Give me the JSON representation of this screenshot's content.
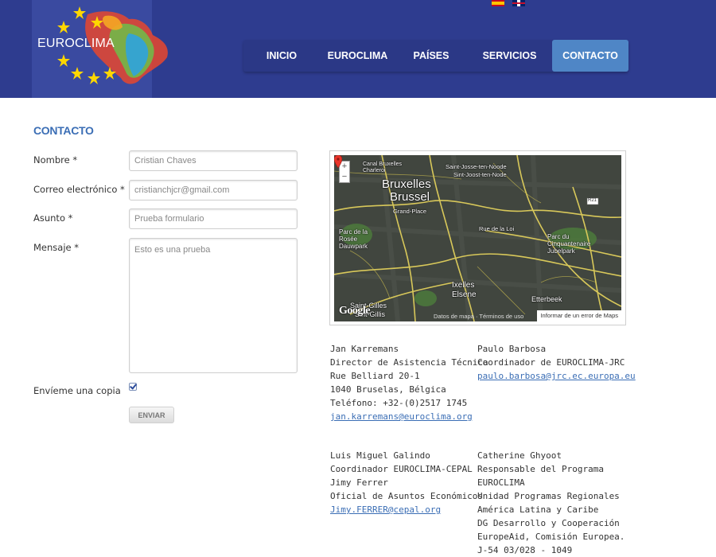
{
  "header": {
    "logo_text": "EUROCLIMA",
    "flags": [
      "flag-spain-icon",
      "flag-uk-icon"
    ],
    "nav": [
      {
        "label": "INICIO",
        "active": false
      },
      {
        "label": "EUROCLIMA",
        "active": false
      },
      {
        "label": "PAÍSES",
        "active": false
      },
      {
        "label": "SERVICIOS",
        "active": false
      },
      {
        "label": "CONTACTO",
        "active": true
      }
    ]
  },
  "page": {
    "title": "CONTACTO"
  },
  "form": {
    "name_label": "Nombre *",
    "name_value": "Cristian Chaves",
    "email_label": "Correo electrónico *",
    "email_value": "cristianchjcr@gmail.com",
    "subject_label": "Asunto *",
    "subject_value": "Prueba formulario",
    "message_label": "Mensaje *",
    "message_value": "Esto es una prueba",
    "copy_label": "Envíeme una copia",
    "copy_checked": true,
    "submit_label": "ENVIAR"
  },
  "map": {
    "zoom_in": "+",
    "zoom_out": "−",
    "labels": {
      "canal": "Canal Bruxelles Charleroi",
      "sjtn_fr": "Saint-Josse-ten-Noode",
      "sjtn_nl": "Sint-Joost-ten-Node",
      "bruxelles": "Bruxelles",
      "brussel": "Brussel",
      "grand_place": "Grand-Place",
      "rue_loi": "Rue de la Loi",
      "parc_rosee": "Parc de la Rosée Dauwpark",
      "parc_cinq": "Parc du Cinquantenaire Jubelpark",
      "ixelles": "Ixelles",
      "elsene": "Elsene",
      "etterbeek": "Etterbeek",
      "saint_gilles": "Saint-Gilles",
      "sint_gillis": "Sint-Gillis",
      "r21": "R21",
      "google": "Google",
      "attribution": "Datos de mapa · Términos de uso",
      "report": "Informar de un error de Maps"
    }
  },
  "contacts": [
    {
      "lines": [
        "Jan Karremans",
        "Director de Asistencia Técnica",
        "Rue Belliard 20-1",
        "1040 Bruselas, Bélgica",
        "Teléfono: +32-(0)2517 1745"
      ],
      "email": "jan.karremans@euroclima.org"
    },
    {
      "lines": [
        "Paulo Barbosa",
        "Coordinador de EUROCLIMA-JRC"
      ],
      "email": "paulo.barbosa@jrc.ec.europa.eu"
    },
    {
      "lines": [
        "Luis Miguel Galindo",
        "Coordinador EUROCLIMA-CEPAL",
        "Jimy Ferrer",
        "Oficial de Asuntos Económicos"
      ],
      "email": "Jimy.FERRER@cepal.org"
    },
    {
      "lines": [
        "Catherine Ghyoot",
        "Responsable del Programa",
        "EUROCLIMA",
        "Unidad Programas Regionales",
        "América Latina y Caribe",
        "DG Desarrollo y Cooperación",
        "EuropeAid, Comisión Europea.",
        "J-54 03/028 - 1049"
      ],
      "email": ""
    }
  ]
}
